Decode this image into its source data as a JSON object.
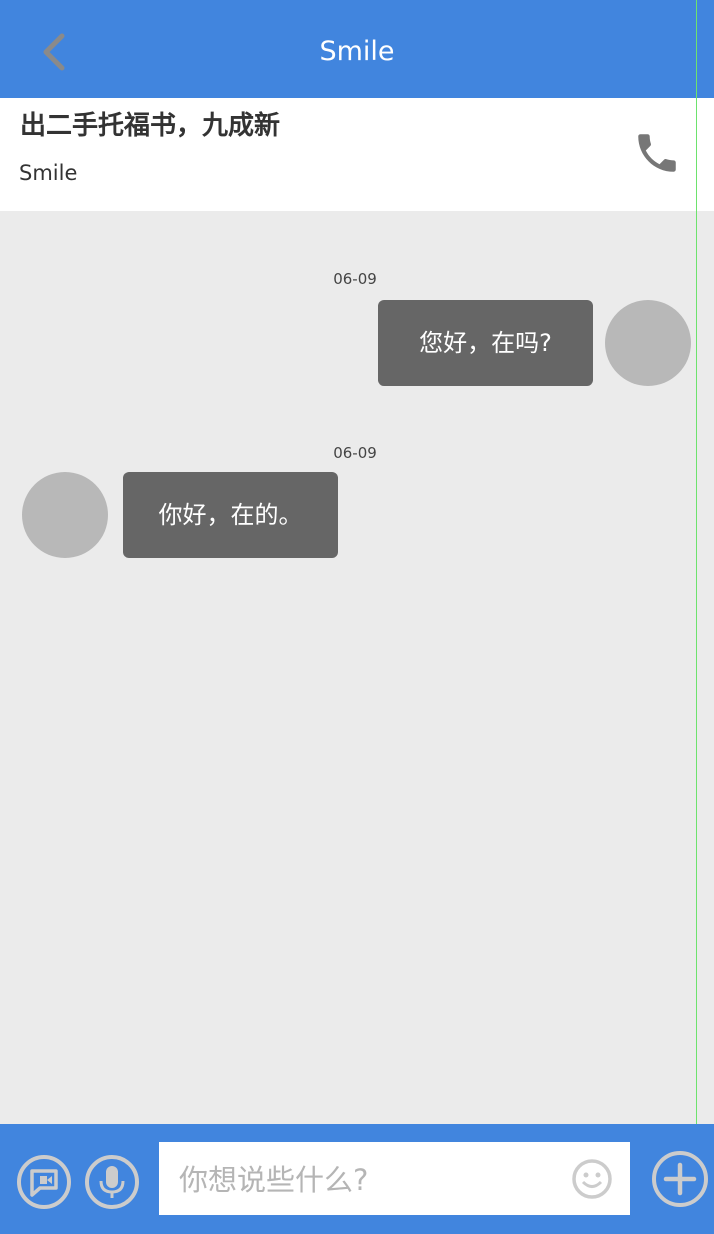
{
  "header": {
    "title": "Smile",
    "back_icon": "chevron-left-icon"
  },
  "product": {
    "title": "出二手托福书，九成新",
    "seller": "Smile",
    "call_icon": "phone-icon"
  },
  "messages": [
    {
      "direction": "outgoing",
      "date": "06-09",
      "text": "您好，在吗?"
    },
    {
      "direction": "incoming",
      "date": "06-09",
      "text": "你好，在的。"
    }
  ],
  "footer": {
    "input_placeholder": "你想说些什么?",
    "input_value": "",
    "icons": [
      "video-chat-icon",
      "microphone-icon",
      "emoji-icon",
      "plus-icon"
    ]
  },
  "colors": {
    "accent": "#4185de",
    "bubble": "#666666",
    "background": "#ebebeb",
    "avatar": "#b8b8b8"
  }
}
